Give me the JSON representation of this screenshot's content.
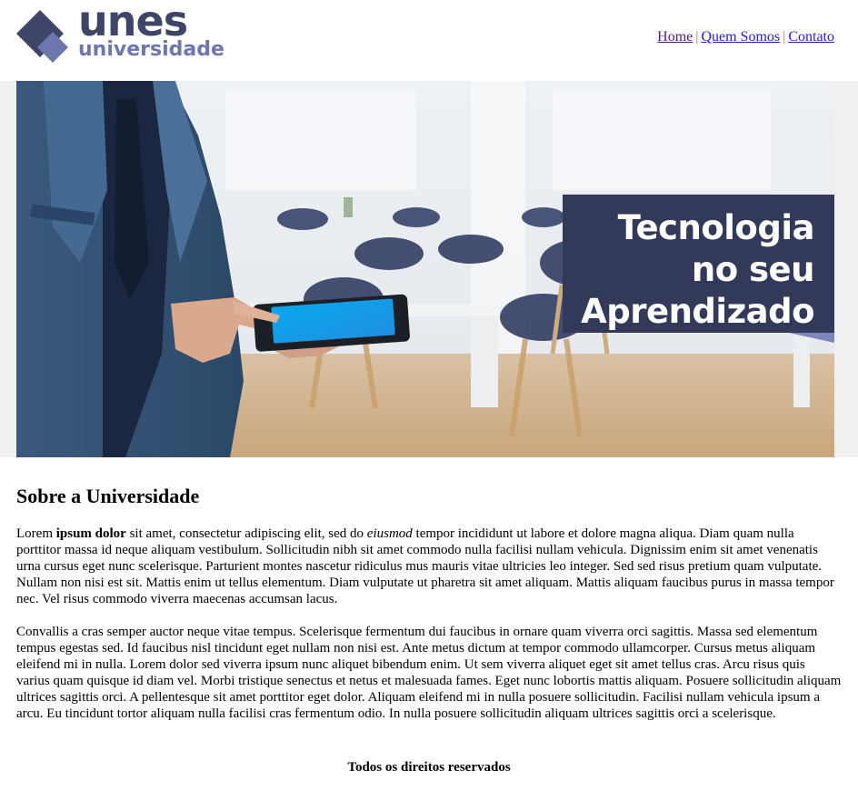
{
  "header": {
    "logo": {
      "word_top": "unes",
      "word_bottom": "universidade"
    },
    "nav": [
      {
        "label": "Home"
      },
      {
        "label": "Quem Somos"
      },
      {
        "label": "Contato"
      }
    ],
    "nav_separator": "|"
  },
  "banner": {
    "caption_lines": [
      "Tecnologia",
      "no seu",
      "Aprendizado"
    ]
  },
  "main": {
    "title": "Sobre a Universidade",
    "p1": {
      "a": "Lorem ",
      "b": "ipsum dolor",
      "c": " sit amet, consectetur adipiscing elit, sed do ",
      "d": "eiusmod",
      "e": " tempor incididunt ut labore et dolore magna aliqua. Diam quam nulla porttitor massa id neque aliquam vestibulum. Sollicitudin nibh sit amet commodo nulla facilisi nullam vehicula. Dignissim enim sit amet venenatis urna cursus eget nunc scelerisque. Parturient montes nascetur ridiculus mus mauris vitae ultricies leo integer. Sed sed risus pretium quam vulputate. Nullam non nisi est sit. Mattis enim ut tellus elementum. Diam vulputate ut pharetra sit amet aliquam. Mattis aliquam faucibus purus in massa tempor nec. Vel risus commodo viverra maecenas accumsan lacus."
    },
    "p2": "Convallis a cras semper auctor neque vitae tempus. Scelerisque fermentum dui faucibus in ornare quam viverra orci sagittis. Massa sed elementum tempus egestas sed. Id faucibus nisl tincidunt eget nullam non nisi est. Ante metus dictum at tempor commodo ullamcorper. Cursus metus aliquam eleifend mi in nulla. Lorem dolor sed viverra ipsum nunc aliquet bibendum enim. Ut sem viverra aliquet eget sit amet tellus cras. Arcu risus quis varius quam quisque id diam vel. Morbi tristique senectus et netus et malesuada fames. Eget nunc lobortis mattis aliquam. Posuere sollicitudin aliquam ultrices sagittis orci. A pellentesque sit amet porttitor eget dolor. Aliquam eleifend mi in nulla posuere sollicitudin. Facilisi nullam vehicula ipsum a arcu. Eu tincidunt tortor aliquam nulla facilisi cras fermentum odio. In nulla posuere sollicitudin aliquam ultrices sagittis orci a scelerisque."
  },
  "footer": {
    "text": "Todos os direitos reservados"
  },
  "colors": {
    "brand_dark": "#3f4566",
    "brand_light": "#6d76ad",
    "caption_bg": "#323959",
    "link": "#2a1ad9",
    "link_visited": "#551a8b"
  }
}
